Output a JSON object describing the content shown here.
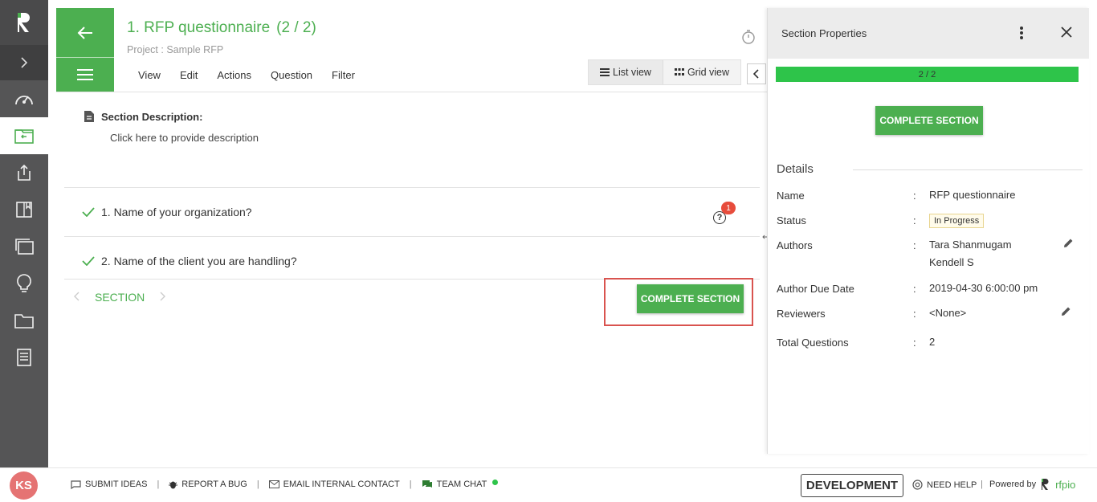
{
  "header": {
    "title": "1. RFP questionnaire",
    "count": "(2 / 2)",
    "project": "Project : Sample RFP",
    "menu": [
      "View",
      "Edit",
      "Actions",
      "Question",
      "Filter"
    ],
    "list_view": "List view",
    "grid_view": "Grid view"
  },
  "content": {
    "section_description_label": "Section Description:",
    "section_description_placeholder": "Click here to provide description",
    "questions": [
      {
        "text": "1. Name of your organization?",
        "comment_count": "1"
      },
      {
        "text": "2. Name of the client you are handling?"
      }
    ],
    "section_nav_label": "SECTION",
    "complete_section_label": "COMPLETE SECTION"
  },
  "panel": {
    "title": "Section Properties",
    "progress_text": "2 / 2",
    "progress_fraction": 1.0,
    "complete_section_label": "COMPLETE SECTION",
    "details_title": "Details",
    "rows": {
      "name": {
        "label": "Name",
        "value": "RFP questionnaire"
      },
      "status": {
        "label": "Status",
        "value": "In Progress"
      },
      "authors": {
        "label": "Authors",
        "value1": "Tara Shanmugam",
        "value2": "Kendell S"
      },
      "due": {
        "label": "Author Due Date",
        "value": "2019-04-30 6:00:00 pm"
      },
      "reviewers": {
        "label": "Reviewers",
        "value": "<None>"
      },
      "total": {
        "label": "Total Questions",
        "value": "2"
      }
    },
    "separator": ":"
  },
  "footer": {
    "avatar_initials": "KS",
    "submit_ideas": "SUBMIT IDEAS",
    "report_bug": "REPORT A BUG",
    "email_contact": "EMAIL INTERNAL CONTACT",
    "team_chat": "TEAM CHAT",
    "separator": "|",
    "environment": "DEVELOPMENT",
    "need_help": "NEED HELP",
    "powered_by": "Powered by",
    "brand": "rfpio"
  },
  "colors": {
    "accent": "#4caf50",
    "sidebar": "#555556",
    "progress": "#2ec44a",
    "highlight": "#d9534f",
    "badge": "#e74c3c",
    "avatar": "#e57373"
  }
}
